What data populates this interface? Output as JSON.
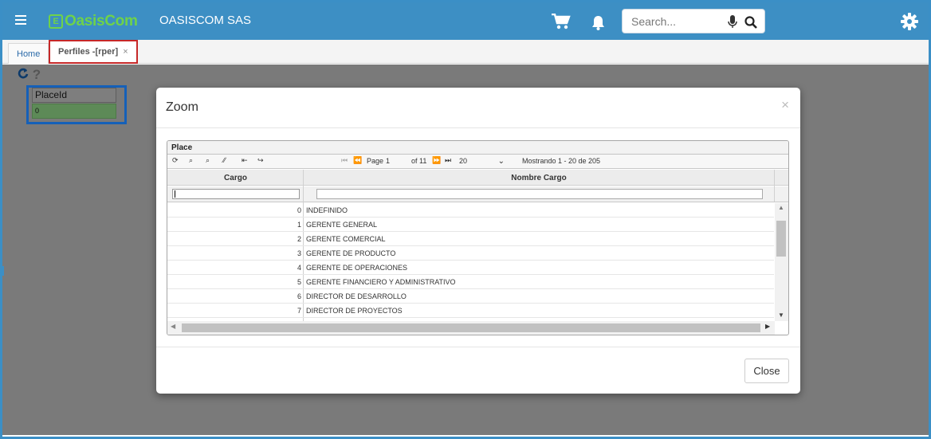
{
  "header": {
    "logo_text": "Oasis",
    "logo_text2": "Com",
    "logo_box": "E",
    "company": "OASISCOM SAS",
    "search_placeholder": "Search..."
  },
  "tabs": [
    {
      "label": "Home"
    },
    {
      "label": "Perfiles -[rper]",
      "close": "×"
    }
  ],
  "form": {
    "place_label": "PlaceId",
    "place_value": "0"
  },
  "modal": {
    "title": "Zoom",
    "close_x": "×",
    "close_button": "Close"
  },
  "grid": {
    "caption": "Place",
    "pager": {
      "page_label": "Page",
      "page_value": "1",
      "of_label": "of 11",
      "page_size": "20",
      "info": "Mostrando 1 - 20 de 205"
    },
    "columns": [
      "Cargo",
      "Nombre Cargo"
    ],
    "rows": [
      {
        "cargo": "0",
        "nombre": "INDEFINIDO"
      },
      {
        "cargo": "1",
        "nombre": "GERENTE GENERAL"
      },
      {
        "cargo": "2",
        "nombre": "GERENTE COMERCIAL"
      },
      {
        "cargo": "3",
        "nombre": "GERENTE DE PRODUCTO"
      },
      {
        "cargo": "4",
        "nombre": "GERENTE DE OPERACIONES"
      },
      {
        "cargo": "5",
        "nombre": "GERENTE FINANCIERO Y ADMINISTRATIVO"
      },
      {
        "cargo": "6",
        "nombre": "DIRECTOR DE DESARROLLO"
      },
      {
        "cargo": "7",
        "nombre": "DIRECTOR DE PROYECTOS"
      }
    ]
  },
  "colors": {
    "topbar": "#3d8fc4",
    "logo_green": "#6fd24a",
    "tab_highlight": "#c62828",
    "field_highlight": "#1560b8"
  }
}
